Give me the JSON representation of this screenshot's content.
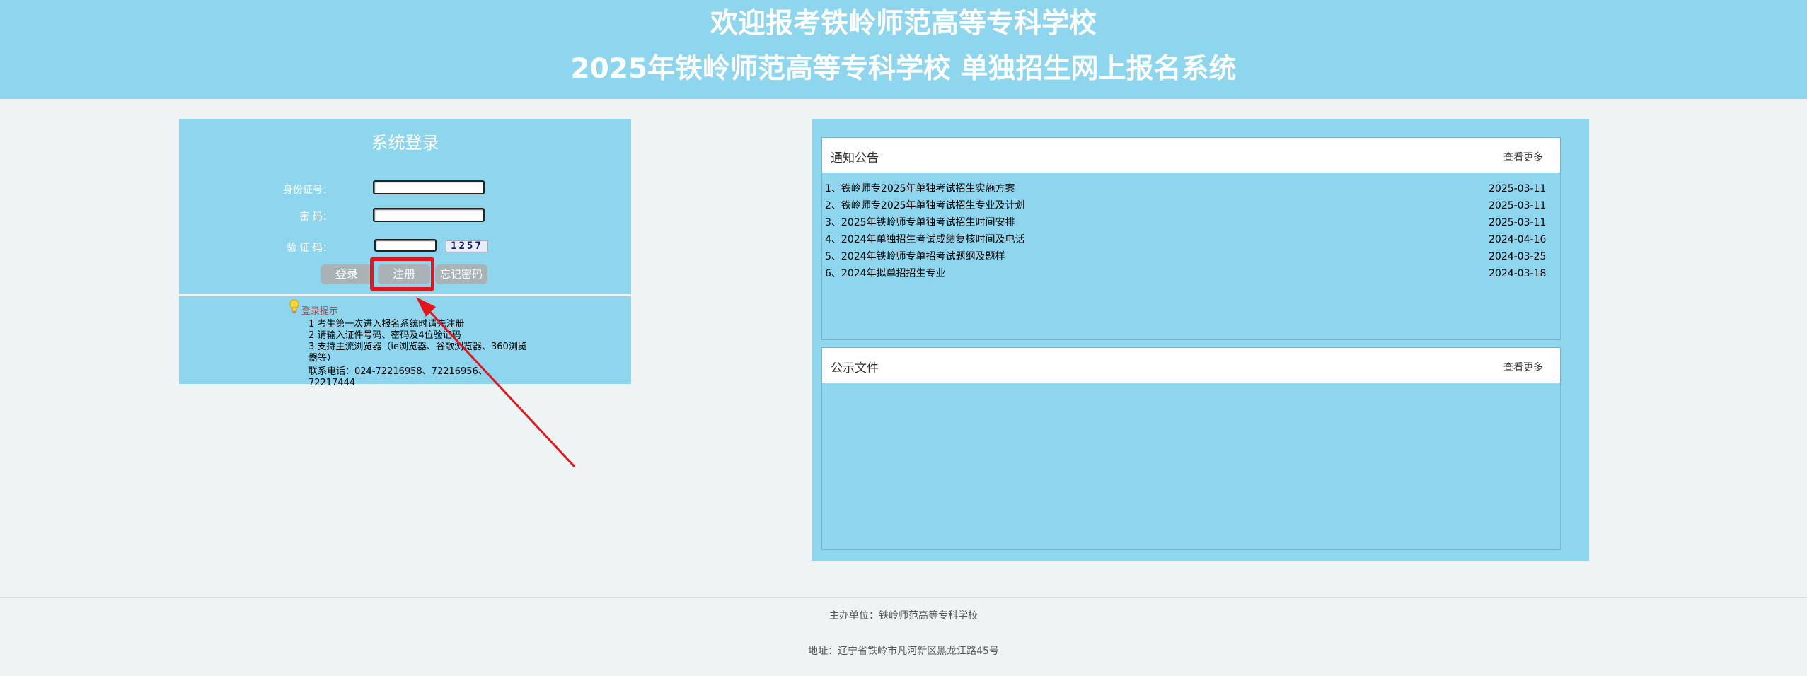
{
  "header": {
    "line1": "欢迎报考铁岭师范高等专科学校",
    "line2": "2025年铁岭师范高等专科学校 单独招生网上报名系统"
  },
  "login": {
    "title": "系统登录",
    "id_label": "身份证号：",
    "id_value": "",
    "password_label": "密 码：",
    "password_value": "",
    "captcha_label": "验 证 码：",
    "captcha_value": "",
    "captcha_image_text": "1257",
    "login_button": "登录",
    "register_button": "注册",
    "forgot_button": "忘记密码"
  },
  "tips": {
    "title": "登录提示",
    "lines": [
      "1 考生第一次进入报名系统时请先注册",
      "2 请输入证件号码、密码及4位验证码",
      "3 支持主流浏览器（ie浏览器、谷歌浏览器、360浏览器等）",
      "联系电话：024-72216958、72216956、72217444"
    ]
  },
  "notices": {
    "title": "通知公告",
    "more": "查看更多",
    "items": [
      {
        "title": "1、铁岭师专2025年单独考试招生实施方案",
        "date": "2025-03-11"
      },
      {
        "title": "2、铁岭师专2025年单独考试招生专业及计划",
        "date": "2025-03-11"
      },
      {
        "title": "3、2025年铁岭师专单独考试招生时间安排",
        "date": "2025-03-11"
      },
      {
        "title": "4、2024年单独招生考试成绩复核时间及电话",
        "date": "2024-04-16"
      },
      {
        "title": "5、2024年铁岭师专单招考试题纲及题样",
        "date": "2024-03-25"
      },
      {
        "title": "6、2024年拟单招招生专业",
        "date": "2024-03-18"
      }
    ]
  },
  "public_files": {
    "title": "公示文件",
    "more": "查看更多"
  },
  "footer": {
    "host": "主办单位：铁岭师范高等专科学校",
    "address": "地址：辽宁省铁岭市凡河新区黑龙江路45号"
  },
  "colors": {
    "header_bg": "#8ed5ee",
    "panel_bg": "#8ed5ee",
    "page_bg": "#eef3f3",
    "button_bg": "#a9b3b6",
    "annotation": "#e8141b"
  }
}
